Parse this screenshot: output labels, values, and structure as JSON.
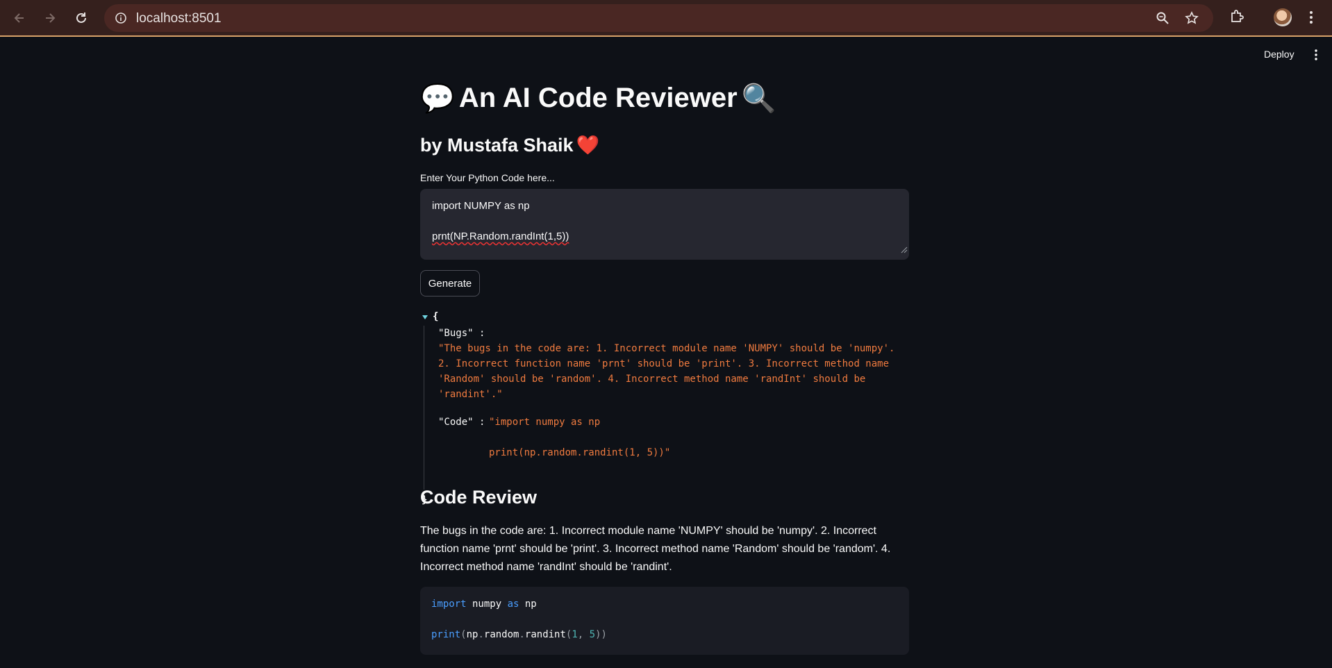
{
  "browser": {
    "url": "localhost:8501",
    "icons": [
      "back-icon",
      "forward-icon",
      "reload-icon",
      "site-info-icon",
      "zoom-icon",
      "bookmark-star-icon",
      "extensions-icon",
      "profile-avatar",
      "menu-icon"
    ]
  },
  "header": {
    "deploy_label": "Deploy"
  },
  "app": {
    "title": "An AI Code Reviewer",
    "title_emoji_left": "💬",
    "title_emoji_right": "🔍",
    "subtitle": "by Mustafa Shaik",
    "subtitle_emoji": "❤️",
    "input_label": "Enter Your Python Code here...",
    "input_lines": [
      "import NUMPY as np",
      "",
      "prnt(NP.Random.randInt(1,5))"
    ],
    "generate_label": "Generate"
  },
  "json_output": {
    "open_brace": "{",
    "close_brace": "}",
    "bugs_key": "\"Bugs\" :",
    "bugs_value": "\"The bugs in the code are: 1. Incorrect module name 'NUMPY' should be 'numpy'. 2. Incorrect function name 'prnt' should be 'print'. 3. Incorrect method name 'Random' should be 'random'. 4. Incorrect method name 'randInt' should be 'randint'.\"",
    "code_key": "\"Code\" :",
    "code_value_line1": "\"import numpy as np",
    "code_value_line2": "print(np.random.randint(1, 5))\""
  },
  "review": {
    "heading": "Code Review",
    "text": "The bugs in the code are: 1. Incorrect module name 'NUMPY' should be 'numpy'. 2. Incorrect function name 'prnt' should be 'print'. 3. Incorrect method name 'Random' should be 'random'. 4. Incorrect method name 'randInt' should be 'randint'.",
    "code": {
      "l1_kw1": "import",
      "l1_mod": " numpy ",
      "l1_kw2": "as",
      "l1_alias": " np",
      "l2_fn": "print",
      "l2_open": "(",
      "l2_obj": "np",
      "l2_dot1": ".",
      "l2_attr": "random",
      "l2_dot2": ".",
      "l2_meth": "randint",
      "l2_open2": "(",
      "l2_n1": "1",
      "l2_comma": ", ",
      "l2_n2": "5",
      "l2_close": "))"
    }
  },
  "colors": {
    "background": "#0e1117",
    "input_bg": "#262730",
    "json_string": "#f07b3f",
    "keyword": "#4a9eff",
    "number": "#4fb6b4",
    "chrome_bg": "#35201d"
  }
}
